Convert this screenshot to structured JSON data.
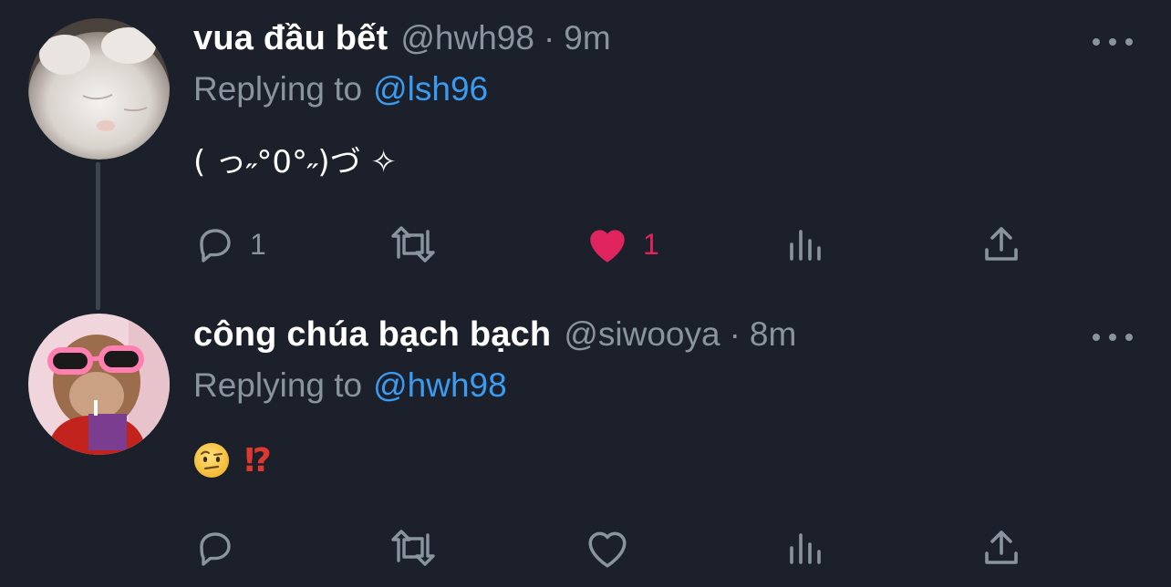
{
  "tweets": [
    {
      "display_name": "vua đầu bết",
      "handle": "@hwh98",
      "separator": "·",
      "time": "9m",
      "replying_prefix": "Replying to",
      "replying_to": "@lsh96",
      "text": "( っ˶°0°˶)づ ✧",
      "reply_count": "1",
      "retweet_count": "",
      "like_count": "1",
      "liked": true
    },
    {
      "display_name": "công chúa bạch bạch",
      "handle": "@siwooya",
      "separator": "·",
      "time": "8m",
      "replying_prefix": "Replying to",
      "replying_to": "@hwh98",
      "text_emoji": [
        "face-with-raised-eyebrow",
        "⁉"
      ],
      "interrobang": "⁉",
      "reply_count": "",
      "retweet_count": "",
      "like_count": "",
      "liked": false
    }
  ],
  "colors": {
    "background": "#1b202a",
    "primary_text": "#ffffff",
    "secondary_text": "#8a949e",
    "link": "#3a9bf0",
    "like_active": "#e0245e",
    "thread_line": "#3d4550"
  }
}
